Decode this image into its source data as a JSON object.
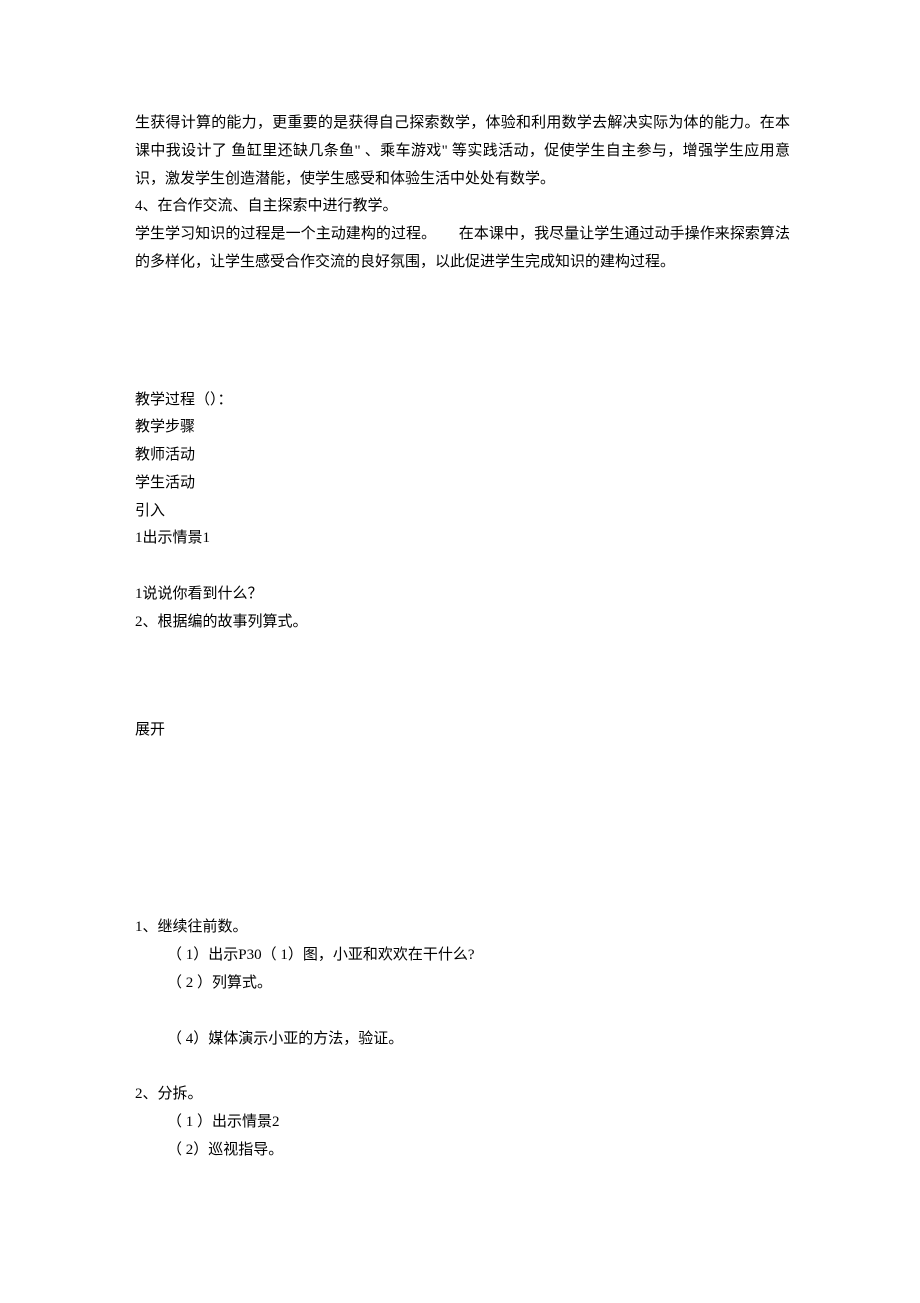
{
  "para1": "生获得计算的能力，更重要的是获得自己探索数学，体验和利用数学去解决实际为体的能力。在本课中我设计了 鱼缸里还缺几条鱼\" 、乘车游戏\" 等实践活动，促使学生自主参与，增强学生应用意识，激发学生创造潜能，使学生感受和体验生活中处处有数学。",
  "heading4": "4、在合作交流、自主探索中进行教学。",
  "para2": "学生学习知识的过程是一个主动建构的过程。　　在本课中，我尽量让学生通过动手操作来探索算法的多样化，让学生感受合作交流的良好氛围，以此促进学生完成知识的建构过程。",
  "process": {
    "heading": "教学过程（）：",
    "steps_label": "教学步骤",
    "teacher_label": "教师活动",
    "student_label": "学生活动",
    "intro_label": "引入",
    "show_scene1": "1出示情景1",
    "q1": "1说说你看到什么？",
    "q2": "2、根据编的故事列算式。",
    "expand_label": "展开",
    "item1": {
      "head": "1、继续往前数。",
      "sub1": "（ 1）出示P30（ 1）图，小亚和欢欢在干什么?",
      "sub2": "（ 2 ）列算式。",
      "sub4": "（ 4）媒体演示小亚的方法，验证。"
    },
    "item2": {
      "head": "2、分拆。",
      "sub1": "（ 1 ）出示情景2",
      "sub2": "（ 2）巡视指导。"
    }
  }
}
